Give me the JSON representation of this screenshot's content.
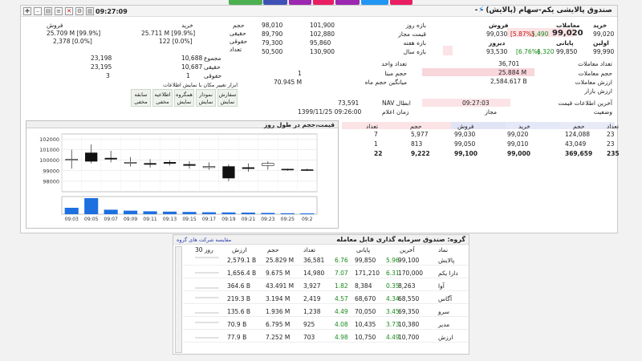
{
  "window": {
    "title": "صندوق پالایشی یکم-سهام (پالایش) - -",
    "time": "09:27:09"
  },
  "colors": {
    "pink": "#fbe3e6",
    "green": "#1a8a1a",
    "red": "#cc1010",
    "blue_bar": "#1e6fe0"
  },
  "right_panel": {
    "col_labels": {
      "buy": "خرید",
      "sell": "فروش",
      "trades": "معاملات",
      "last": "آخرین",
      "close": "پایانی"
    },
    "trade_value": "99,020",
    "last_change": "5,490",
    "last_pct": "[5.87%]",
    "buy_first": "99,020",
    "sell_first": "99,030",
    "open_label": "اولین",
    "open_value": "93,530",
    "yesterday_label": "دیروز",
    "close_value": "99,850",
    "close_change": "6,320",
    "close_pct": "[6.76%]",
    "buy2": "99,990"
  },
  "ranges": {
    "day_label": "بازه روز",
    "day_low": "98,010",
    "day_high": "101,900",
    "allowed_label": "قیمت مجاز",
    "allowed_low": "89,790",
    "allowed_high": "102,880",
    "week_label": "بازه هفته",
    "week_low": "79,300",
    "week_high": "95,860",
    "year_label": "بازه سال",
    "year_low": "50,500",
    "year_high": "130,900"
  },
  "ownership": {
    "volume_label": "حجم",
    "buy_label": "خرید",
    "sell_label": "فروش",
    "real_label": "حقیقی",
    "legal_label": "حقوقی",
    "count_label": "تعداد",
    "total_label": "مجموع",
    "buy_real": "25.711 M [99.9%]",
    "sell_real": "25.709 M [99.9%]",
    "buy_legal": "122 [0.0%]",
    "sell_legal": "2,378 [0.0%]",
    "total_buy": "10,688",
    "total_sell": "23,198",
    "count_real_buy": "10,687",
    "count_real_sell": "23,195",
    "count_legal_buy": "1",
    "count_legal_sell": "3"
  },
  "stats": {
    "trades_count_label": "تعداد معاملات",
    "trades_count": "36,701",
    "volume_label": "حجم معاملات",
    "volume": "25.884 M",
    "value_label": "ارزش معاملات",
    "value": "2,584.617 B",
    "market_value_label": "ارزش بازار",
    "unit_count_label": "تعداد واحد",
    "base_volume_label": "حجم مبنا",
    "base_volume": "1",
    "avg_month_label": "میانگین حجم ماه",
    "avg_month": "70.945 M",
    "last_update_label": "آخرین اطلاعات قیمت",
    "last_update": "09:27:03",
    "status_label": "وضعیت",
    "status": "مجاز",
    "nav_label": "NAV ابطال",
    "nav": "73,591",
    "nav_time_label": "زمان اعلام",
    "nav_time": "1399/11/25 09:26:00"
  },
  "tools": {
    "title": "ابزار تغییر مکان با نمایش اطلاعات",
    "buttons": [
      {
        "top": "سفارش",
        "bottom": "نمایش"
      },
      {
        "top": "نمودار",
        "bottom": "نمایش"
      },
      {
        "top": "همگروه",
        "bottom": "نمایش"
      },
      {
        "top": "اطلاعیه",
        "bottom": "مخفی"
      },
      {
        "top": "سابقه",
        "bottom": "مخفی"
      }
    ]
  },
  "chart_data": {
    "type": "candlestick",
    "title": "قیمت،حجم در طول روز",
    "ylim": [
      97000,
      102500
    ],
    "yticks": [
      "102000",
      "101000",
      "100000",
      "99000",
      "98000"
    ],
    "categories": [
      "09:03",
      "09:05",
      "09:07",
      "09:09",
      "09:11",
      "09:13",
      "09:15",
      "09:17",
      "09:19",
      "09:21",
      "09:23",
      "09:25",
      "09:2"
    ],
    "candles": [
      {
        "open": 100000,
        "close": 100100,
        "high": 101000,
        "low": 99200
      },
      {
        "open": 100700,
        "close": 99900,
        "high": 101500,
        "low": 99700
      },
      {
        "open": 100200,
        "close": 100100,
        "high": 100900,
        "low": 99800
      },
      {
        "open": 99700,
        "close": 99800,
        "high": 100300,
        "low": 99400
      },
      {
        "open": 99700,
        "close": 99600,
        "high": 100100,
        "low": 99300
      },
      {
        "open": 99800,
        "close": 99700,
        "high": 100000,
        "low": 99500
      },
      {
        "open": 99600,
        "close": 99500,
        "high": 99900,
        "low": 99200
      },
      {
        "open": 99300,
        "close": 99400,
        "high": 99800,
        "low": 99100
      },
      {
        "open": 99400,
        "close": 98300,
        "high": 99600,
        "low": 98000
      },
      {
        "open": 99300,
        "close": 99200,
        "high": 99700,
        "low": 98900
      },
      {
        "open": 99500,
        "close": 99700,
        "high": 99900,
        "low": 99100
      },
      {
        "open": 99150,
        "close": 99100,
        "high": 99200,
        "low": 99000
      },
      {
        "open": 99100,
        "close": 99050,
        "high": 99200,
        "low": 99000
      }
    ],
    "volumes": [
      40,
      100,
      28,
      22,
      18,
      16,
      14,
      12,
      11,
      10,
      8,
      6,
      5
    ]
  },
  "orderbook": {
    "headers": [
      "تعداد",
      "حجم",
      "خرید",
      "فروش",
      "حجم",
      "تعداد"
    ],
    "rows": [
      {
        "buy_count": "23",
        "buy_vol": "124,088",
        "buy_price": "99,020",
        "sell_price": "99,030",
        "sell_vol": "5,977",
        "sell_count": "7"
      },
      {
        "buy_count": "23",
        "buy_vol": "43,049",
        "buy_price": "99,010",
        "sell_price": "99,050",
        "sell_vol": "813",
        "sell_count": "1"
      },
      {
        "buy_count": "235",
        "buy_vol": "369,659",
        "buy_price": "99,000",
        "sell_price": "99,100",
        "sell_vol": "9,222",
        "sell_count": "22"
      }
    ]
  },
  "group": {
    "title": "گروه: صندوق سرمایه گذاری قابل معامله",
    "compare_link": "مقایسه شرکت های گروه",
    "headers": [
      "نماد",
      "آخرین",
      "",
      "پایانی",
      "",
      "تعداد",
      "حجم",
      "ارزش",
      "30 روز"
    ],
    "rows": [
      {
        "name": "پالایش",
        "last": "99,100",
        "last_pct": "5.96",
        "close": "99,850",
        "close_pct": "6.76",
        "count": "36,581",
        "vol": "25.829 M",
        "value": "2,579.1 B"
      },
      {
        "name": "دارا یکم",
        "last": "170,000",
        "last_pct": "6.31",
        "close": "171,210",
        "close_pct": "7.07",
        "count": "14,980",
        "vol": "9.675 M",
        "value": "1,656.4 B"
      },
      {
        "name": "آوا",
        "last": "8,263",
        "last_pct": "0.35",
        "close": "8,384",
        "close_pct": "1.82",
        "count": "3,927",
        "vol": "43.491 M",
        "value": "364.6 B"
      },
      {
        "name": "آگاس",
        "last": "68,550",
        "last_pct": "4.34",
        "close": "68,670",
        "close_pct": "4.57",
        "count": "2,419",
        "vol": "3.194 M",
        "value": "219.3 B"
      },
      {
        "name": "سرو",
        "last": "69,350",
        "last_pct": "3.45",
        "close": "70,050",
        "close_pct": "4.49",
        "count": "1,238",
        "vol": "1.936 M",
        "value": "135.6 B"
      },
      {
        "name": "مدیر",
        "last": "10,380",
        "last_pct": "3.73",
        "close": "10,435",
        "close_pct": "4.08",
        "count": "925",
        "vol": "6.795 M",
        "value": "70.9 B"
      },
      {
        "name": "ارزش",
        "last": "10,700",
        "last_pct": "4.49",
        "close": "10,750",
        "close_pct": "4.98",
        "count": "703",
        "vol": "7.252 M",
        "value": "77.9 B"
      }
    ]
  }
}
